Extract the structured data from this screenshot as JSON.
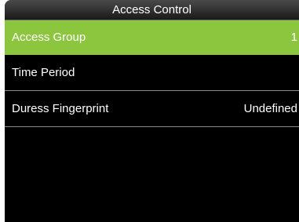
{
  "header": {
    "title": "Access Control"
  },
  "menu": {
    "items": [
      {
        "label": "Access Group",
        "value": "1",
        "selected": true
      },
      {
        "label": "Time Period",
        "value": "",
        "selected": false
      },
      {
        "label": "Duress Fingerprint",
        "value": "Undefined",
        "selected": false
      }
    ]
  },
  "colors": {
    "accent": "#8cc63f",
    "background": "#000000",
    "text": "#ffffff"
  }
}
